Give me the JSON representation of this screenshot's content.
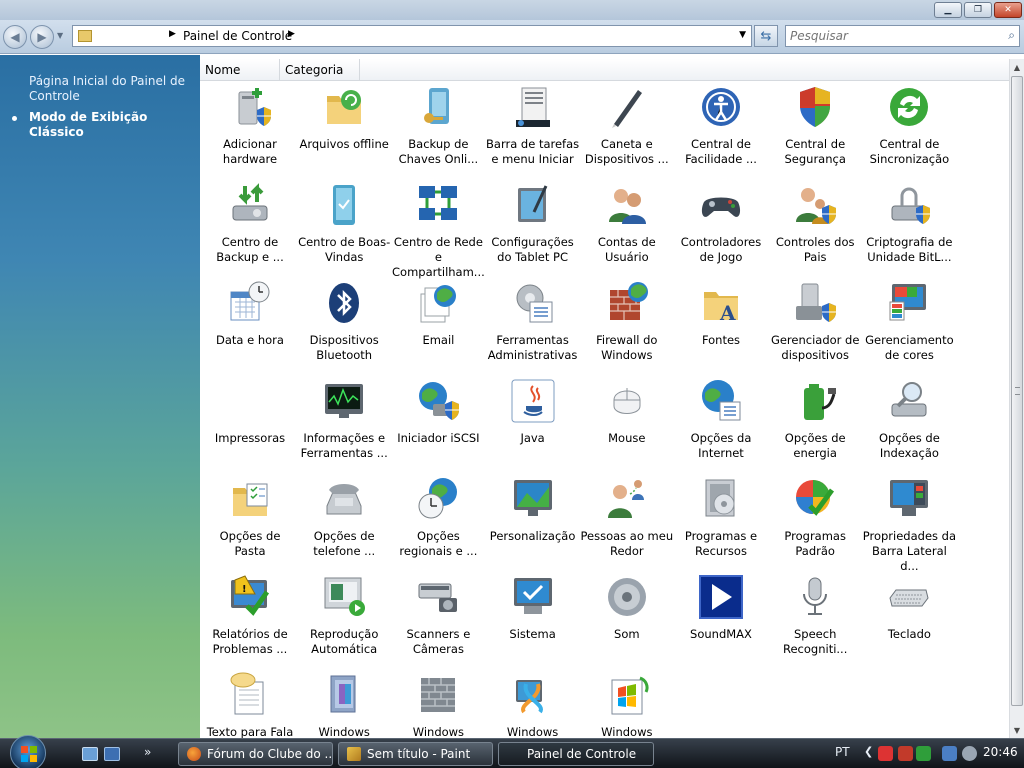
{
  "window": {
    "title": "Painel de Controle"
  },
  "navigation": {
    "address_crumb": "Painel de Controle",
    "search_placeholder": "Pesquisar"
  },
  "left_pane": {
    "links": [
      {
        "label": "Página Inicial do Painel de Controle"
      },
      {
        "label": "Modo de Exibição Clássico"
      }
    ]
  },
  "columns": [
    "Nome",
    "Categoria"
  ],
  "items": [
    {
      "label": "Adicionar hardware",
      "icon": "add-hardware-icon"
    },
    {
      "label": "Arquivos offline",
      "icon": "offline-files-icon"
    },
    {
      "label": "Backup de Chaves Onli...",
      "icon": "key-backup-icon"
    },
    {
      "label": "Barra de tarefas e menu Iniciar",
      "icon": "taskbar-start-menu-icon"
    },
    {
      "label": "Caneta e Dispositivos ...",
      "icon": "pen-devices-icon"
    },
    {
      "label": "Central de Facilidade ...",
      "icon": "ease-of-access-icon"
    },
    {
      "label": "Central de Segurança",
      "icon": "security-center-icon"
    },
    {
      "label": "Central de Sincronização",
      "icon": "sync-center-icon"
    },
    {
      "label": "Centro de Backup e ...",
      "icon": "backup-center-icon"
    },
    {
      "label": "Centro de Boas-Vindas",
      "icon": "welcome-center-icon"
    },
    {
      "label": "Centro de Rede e Compartilham...",
      "icon": "network-sharing-icon"
    },
    {
      "label": "Configurações do Tablet PC",
      "icon": "tablet-pc-icon"
    },
    {
      "label": "Contas de Usuário",
      "icon": "user-accounts-icon"
    },
    {
      "label": "Controladores de Jogo",
      "icon": "game-controllers-icon"
    },
    {
      "label": "Controles dos Pais",
      "icon": "parental-controls-icon"
    },
    {
      "label": "Criptografia de Unidade BitL...",
      "icon": "bitlocker-icon"
    },
    {
      "label": "Data e hora",
      "icon": "date-time-icon"
    },
    {
      "label": "Dispositivos Bluetooth",
      "icon": "bluetooth-icon"
    },
    {
      "label": "Email",
      "icon": "email-icon"
    },
    {
      "label": "Ferramentas Administrativas",
      "icon": "admin-tools-icon"
    },
    {
      "label": "Firewall do Windows",
      "icon": "firewall-icon"
    },
    {
      "label": "Fontes",
      "icon": "fonts-icon"
    },
    {
      "label": "Gerenciador de dispositivos",
      "icon": "device-manager-icon"
    },
    {
      "label": "Gerenciamento de cores",
      "icon": "color-management-icon"
    },
    {
      "label": "Impressoras",
      "icon": "printers-icon"
    },
    {
      "label": "Informações e Ferramentas ...",
      "icon": "performance-info-icon"
    },
    {
      "label": "Iniciador iSCSI",
      "icon": "iscsi-icon"
    },
    {
      "label": "Java",
      "icon": "java-icon"
    },
    {
      "label": "Mouse",
      "icon": "mouse-icon"
    },
    {
      "label": "Opções da Internet",
      "icon": "internet-options-icon"
    },
    {
      "label": "Opções de energia",
      "icon": "power-options-icon"
    },
    {
      "label": "Opções de Indexação",
      "icon": "indexing-options-icon"
    },
    {
      "label": "Opções de Pasta",
      "icon": "folder-options-icon"
    },
    {
      "label": "Opções de telefone ...",
      "icon": "phone-modem-icon"
    },
    {
      "label": "Opções regionais e ...",
      "icon": "regional-options-icon"
    },
    {
      "label": "Personalização",
      "icon": "personalization-icon"
    },
    {
      "label": "Pessoas ao meu Redor",
      "icon": "people-near-me-icon"
    },
    {
      "label": "Programas e Recursos",
      "icon": "programs-features-icon"
    },
    {
      "label": "Programas Padrão",
      "icon": "default-programs-icon"
    },
    {
      "label": "Propriedades da Barra Lateral d...",
      "icon": "sidebar-properties-icon"
    },
    {
      "label": "Relatórios de Problemas ...",
      "icon": "problem-reports-icon"
    },
    {
      "label": "Reprodução Automática",
      "icon": "autoplay-icon"
    },
    {
      "label": "Scanners e Câmeras",
      "icon": "scanners-cameras-icon"
    },
    {
      "label": "Sistema",
      "icon": "system-icon"
    },
    {
      "label": "Som",
      "icon": "sound-icon"
    },
    {
      "label": "SoundMAX",
      "icon": "soundmax-icon"
    },
    {
      "label": "Speech Recogniti...",
      "icon": "speech-recognition-icon"
    },
    {
      "label": "Teclado",
      "icon": "keyboard-icon"
    },
    {
      "label": "Texto para Fala",
      "icon": "text-to-speech-icon"
    },
    {
      "label": "Windows",
      "icon": "windows-cardspace-icon"
    },
    {
      "label": "Windows",
      "icon": "windows-defender-icon"
    },
    {
      "label": "Windows",
      "icon": "windows-mobility-icon"
    },
    {
      "label": "Windows Update",
      "icon": "windows-update-icon"
    }
  ],
  "taskbar": {
    "tasks": [
      {
        "label": "Fórum do Clube do ..."
      },
      {
        "label": "Sem título - Paint"
      },
      {
        "label": "Painel de Controle"
      }
    ],
    "language": "PT",
    "clock": "20:46"
  }
}
